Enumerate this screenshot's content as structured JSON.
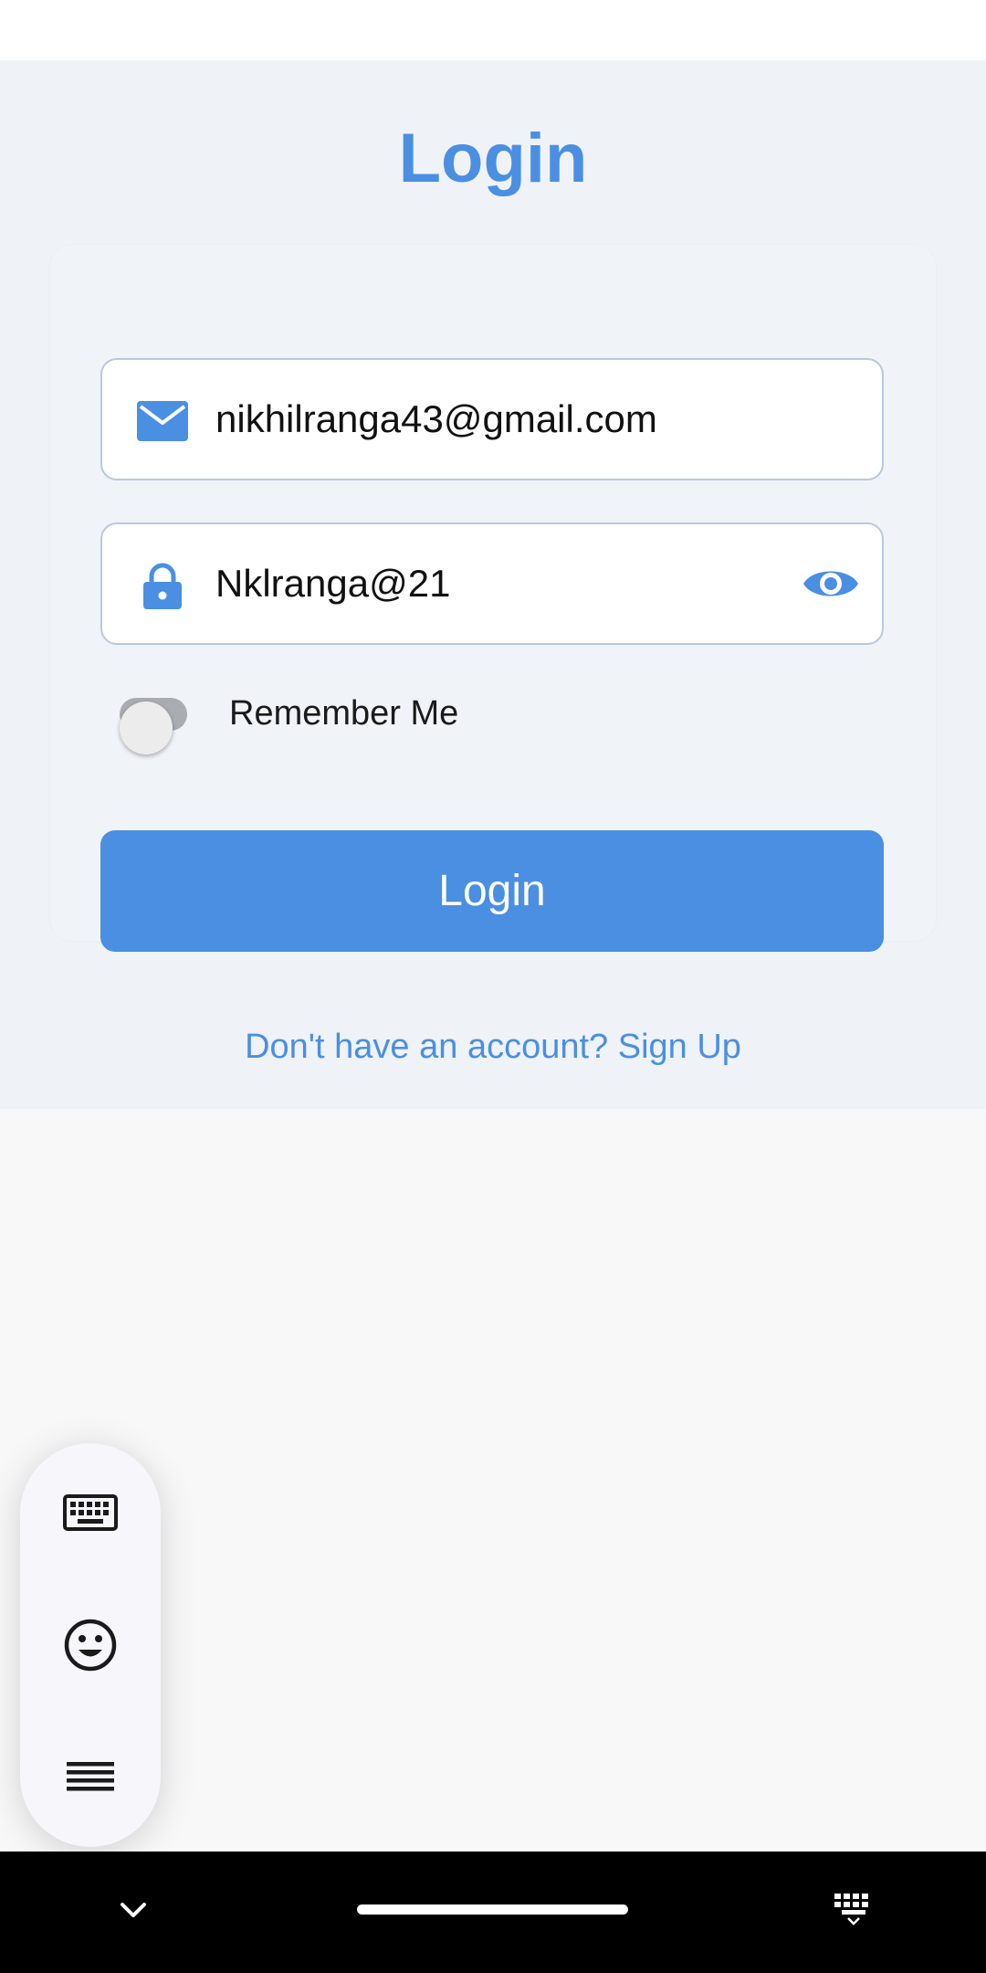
{
  "page": {
    "title": "Login",
    "accent_color": "#4a8fe2"
  },
  "form": {
    "email": {
      "icon": "mail-icon",
      "value": "nikhilranga43@gmail.com"
    },
    "password": {
      "icon": "lock-icon",
      "value": "Nklranga@21",
      "toggle_icon": "eye-icon"
    },
    "remember_me": {
      "label": "Remember Me",
      "checked": false
    },
    "login_button": {
      "label": "Login"
    }
  },
  "signup": {
    "text": "Don't have an account? Sign Up"
  },
  "keyboard_panel": {
    "icons": [
      "keyboard-icon",
      "emoji-icon",
      "menu-icon"
    ]
  },
  "nav_bar": {
    "icons": [
      "chevron-down-icon",
      "home-indicator",
      "keyboard-switch-icon"
    ]
  }
}
